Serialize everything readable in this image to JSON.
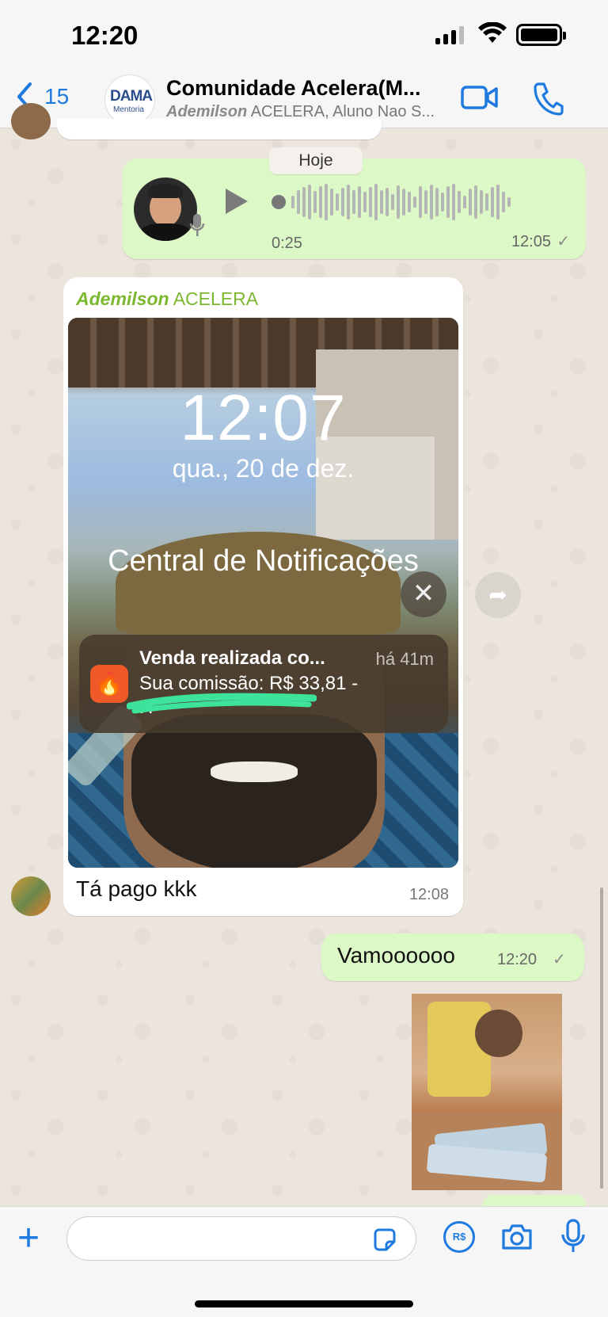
{
  "status_bar": {
    "time": "12:20"
  },
  "header": {
    "back_count": "15",
    "group_logo_main": "DAMA",
    "group_logo_sub": "Mentoria",
    "title": "Comunidade Acelera(M...",
    "subtitle_bold": "Ademilson",
    "subtitle_rest": " ACELERA, Aluno Nao S..."
  },
  "messages": {
    "date_chip": "Hoje",
    "voice": {
      "duration": "0:25",
      "time": "12:05",
      "status": "✓"
    },
    "image_message": {
      "sender_first": "Ademilson",
      "sender_last": " ACELERA",
      "lock_time": "12:07",
      "lock_date": "qua., 20 de dez.",
      "notification_center": "Central de Notificações",
      "notif_title": "Venda realizada co...",
      "notif_ago": "há 41m",
      "notif_body": "Sua comissão: R$ 33,81 -",
      "notif_body2": "H",
      "caption": "Tá pago kkk",
      "time": "12:08"
    },
    "outgoing_text": {
      "text": "Vamoooooo",
      "time": "12:20",
      "status": "✓"
    }
  },
  "composer": {
    "placeholder": "",
    "pay_label": "R$"
  },
  "colors": {
    "accent": "#1f7ae0",
    "bubble_out": "#dcf8c6",
    "sender_name": "#7cb82f"
  },
  "icons": [
    "back-icon",
    "video-call-icon",
    "phone-icon",
    "play-icon",
    "mic-icon",
    "forward-icon",
    "close-icon",
    "plus-icon",
    "sticker-icon",
    "camera-icon"
  ]
}
